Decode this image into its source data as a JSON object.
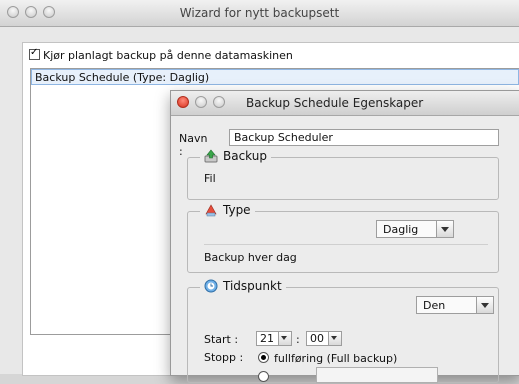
{
  "window": {
    "title": "Wizard for nytt backupsett"
  },
  "main": {
    "checkbox_label": "Kjør planlagt backup på denne datamaskinen",
    "list_item": "Backup Schedule (Type: Daglig)"
  },
  "dialog": {
    "title": "Backup Schedule Egenskaper",
    "name_label": "Navn :",
    "name_value": "Backup Scheduler",
    "backup_group": {
      "label": "Backup",
      "value": "Fil"
    },
    "type_group": {
      "label": "Type",
      "select_value": "Daglig",
      "description": "Backup hver dag"
    },
    "time_group": {
      "label": "Tidspunkt",
      "select_value": "Den",
      "start_label": "Start :",
      "start_hour": "21",
      "separator": ":",
      "start_minute": "00",
      "stop_label": "Stopp :",
      "stop_option": "fullføring (Full backup)"
    }
  }
}
